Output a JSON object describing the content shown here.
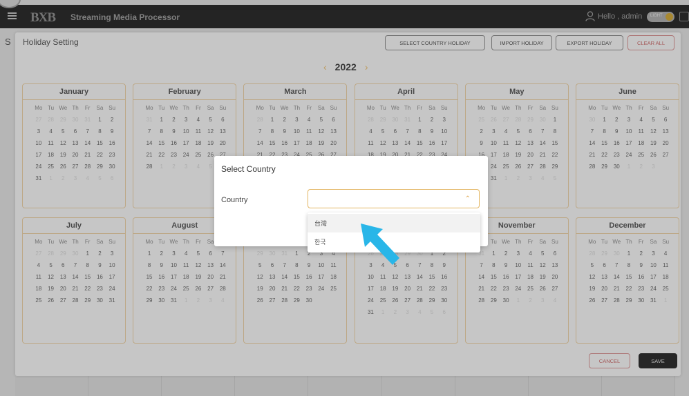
{
  "header": {
    "logo": "BXB",
    "title": "Streaming Media Processor",
    "user_greeting": "Hello , admin",
    "theme_toggle_label": "LIGHT"
  },
  "background_page": {
    "initial": "S"
  },
  "holiday": {
    "title": "Holiday Setting",
    "buttons": {
      "select_country": "SELECT COUNTRY HOLIDAY",
      "import": "IMPORT HOLIDAY",
      "export": "EXPORT HOLIDAY",
      "clear_all": "CLEAR ALL",
      "cancel": "CANCEL",
      "save": "SAVE"
    },
    "year": "2022",
    "year_prev_icon": "chevron-left-icon",
    "year_next_icon": "chevron-right-icon"
  },
  "calendar": {
    "weekday_headers": [
      "Mo",
      "Tu",
      "We",
      "Th",
      "Fr",
      "Sa",
      "Su"
    ],
    "months": [
      {
        "name": "January",
        "lead": [
          27,
          28,
          29,
          30,
          31
        ],
        "days": 31,
        "trail": [
          1,
          2,
          3,
          4,
          5,
          6
        ]
      },
      {
        "name": "February",
        "lead": [
          31
        ],
        "days": 28,
        "trail": [
          1,
          2,
          3,
          4,
          5,
          6
        ]
      },
      {
        "name": "March",
        "lead": [
          28
        ],
        "days": 31,
        "trail": [
          1,
          2,
          3
        ]
      },
      {
        "name": "April",
        "lead": [
          28,
          29,
          30,
          31
        ],
        "days": 30,
        "trail": [
          1
        ]
      },
      {
        "name": "May",
        "lead": [
          25,
          26,
          27,
          28,
          29,
          30
        ],
        "days": 31,
        "trail": [
          1,
          2,
          3,
          4,
          5
        ]
      },
      {
        "name": "June",
        "lead": [
          30
        ],
        "days": 30,
        "trail": [
          1,
          2,
          3
        ]
      },
      {
        "name": "July",
        "lead": [
          27,
          28,
          29,
          30
        ],
        "days": 31,
        "trail": []
      },
      {
        "name": "August",
        "lead": [],
        "days": 31,
        "trail": [
          1,
          2,
          3,
          4
        ]
      },
      {
        "name": "September",
        "lead": [
          29,
          30,
          31
        ],
        "days": 30,
        "trail": []
      },
      {
        "name": "October",
        "lead": [
          26,
          27,
          28,
          29,
          30
        ],
        "days": 31,
        "trail": [
          1,
          2,
          3,
          4,
          5,
          6
        ]
      },
      {
        "name": "November",
        "lead": [
          31
        ],
        "days": 30,
        "trail": [
          1,
          2,
          3,
          4
        ]
      },
      {
        "name": "December",
        "lead": [
          28,
          29,
          30
        ],
        "days": 31,
        "trail": [
          1
        ]
      }
    ]
  },
  "modal": {
    "title": "Select Country",
    "country_label": "Country",
    "country_value": "",
    "options": [
      "台灣",
      "한국"
    ]
  },
  "colors": {
    "accent": "#e3b560",
    "pointer": "#29b6e8",
    "topbar": "#2b2b2b"
  }
}
